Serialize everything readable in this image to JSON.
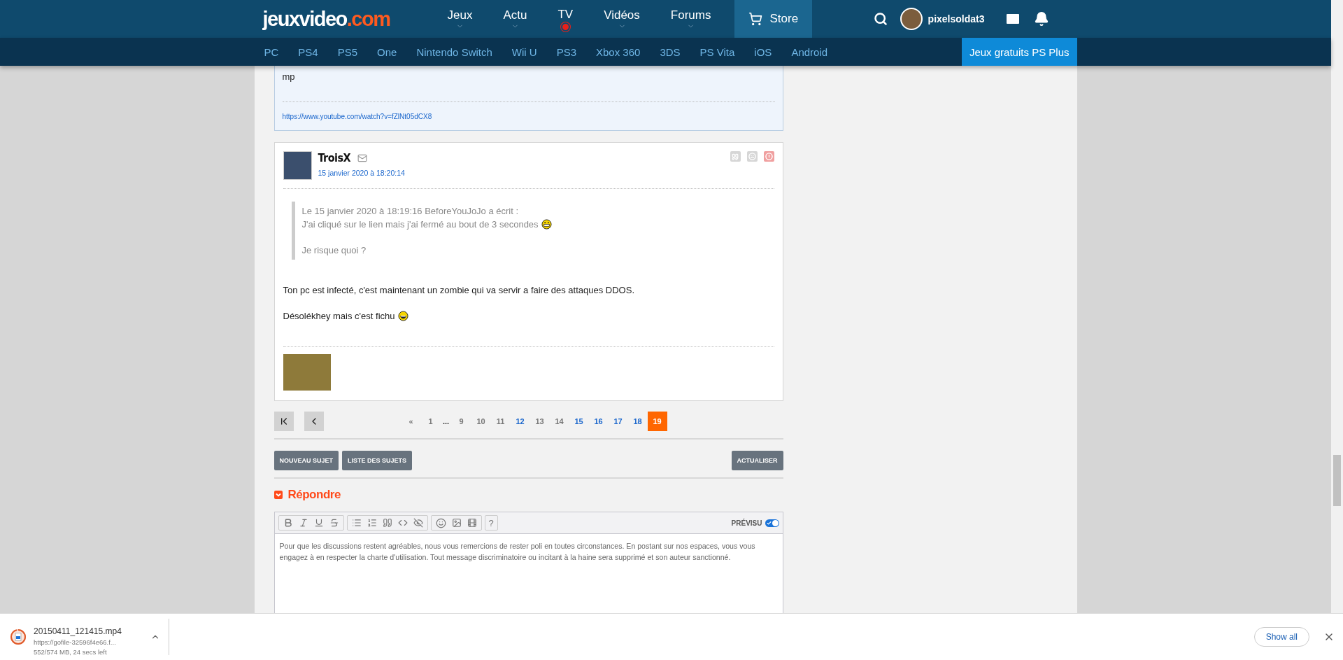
{
  "header": {
    "logo_main": "jeuxvideo",
    "logo_suffix": ".com",
    "nav": [
      {
        "label": "Jeux",
        "kind": "dropdown"
      },
      {
        "label": "Actu",
        "kind": "dropdown"
      },
      {
        "label": "TV",
        "kind": "live"
      },
      {
        "label": "Vidéos",
        "kind": "dropdown"
      },
      {
        "label": "Forums",
        "kind": "dropdown"
      },
      {
        "label": "Store",
        "kind": "store"
      }
    ],
    "username": "pixelsoldat3"
  },
  "platforms": [
    "PC",
    "PS4",
    "PS5",
    "One",
    "Nintendo Switch",
    "Wii U",
    "PS3",
    "Xbox 360",
    "3DS",
    "PS Vita",
    "iOS",
    "Android"
  ],
  "promo": "Jeux gratuits PS Plus",
  "previous_post": {
    "text": "mp",
    "link": "https://www.youtube.com/watch?v=fZlNt05dCX8"
  },
  "post": {
    "author": "TroisX",
    "date": "15 janvier 2020 à 18:20:14",
    "quote": {
      "header": "Le 15 janvier 2020 à 18:19:16 BeforeYouJoJo a écrit :",
      "lines": [
        {
          "text": "J'ai cliqué sur le lien mais j'ai fermé au bout de 3 secondes",
          "kind": "grin"
        },
        {
          "text": "Je risque quoi ?",
          "kind": "plain"
        }
      ]
    },
    "paragraphs": [
      {
        "text": "Ton pc est infecté, c'est maintenant un zombie qui va servir a faire des attaques DDOS.",
        "kind": "plain"
      },
      {
        "text": "Désolékhey mais c'est fichu",
        "kind": "laugh"
      }
    ]
  },
  "pagination": [
    {
      "label": "«",
      "kind": "arrow"
    },
    {
      "label": "1",
      "kind": "page",
      "visited": true,
      "selected": false
    },
    {
      "label": "...",
      "kind": "ellipsis"
    },
    {
      "label": "9",
      "kind": "page",
      "visited": true,
      "selected": false
    },
    {
      "label": "10",
      "kind": "page",
      "visited": true,
      "selected": false
    },
    {
      "label": "11",
      "kind": "page",
      "visited": true,
      "selected": false
    },
    {
      "label": "12",
      "kind": "page",
      "visited": false,
      "selected": false
    },
    {
      "label": "13",
      "kind": "page",
      "visited": true,
      "selected": false
    },
    {
      "label": "14",
      "kind": "page",
      "visited": true,
      "selected": false
    },
    {
      "label": "15",
      "kind": "page",
      "visited": false,
      "selected": false
    },
    {
      "label": "16",
      "kind": "page",
      "visited": false,
      "selected": false
    },
    {
      "label": "17",
      "kind": "page",
      "visited": false,
      "selected": false
    },
    {
      "label": "18",
      "kind": "page",
      "visited": false,
      "selected": false
    },
    {
      "label": "19",
      "kind": "page",
      "visited": false,
      "selected": true
    }
  ],
  "buttons": [
    "NOUVEAU SUJET",
    "LISTE DES SUJETS"
  ],
  "refresh_button": "ACTUALISER",
  "reply": {
    "title": "Répondre",
    "help": "?",
    "preview_label": "PRÉVISU",
    "preview_on": true,
    "placeholder": "Pour que les discussions restent agréables, nous vous remercions de rester poli en toutes circonstances. En postant sur nos espaces, vous vous engagez à en respecter la charte d'utilisation. Tout message discriminatoire ou incitant à la haine sera supprimé et son auteur sanctionné."
  },
  "download": {
    "filename": "20150411_121415.mp4",
    "source": "https://gofile-32596f4e66.f...",
    "progress": "552/574 MB, 24 secs left",
    "level": 0.96
  },
  "show_all": "Show all"
}
